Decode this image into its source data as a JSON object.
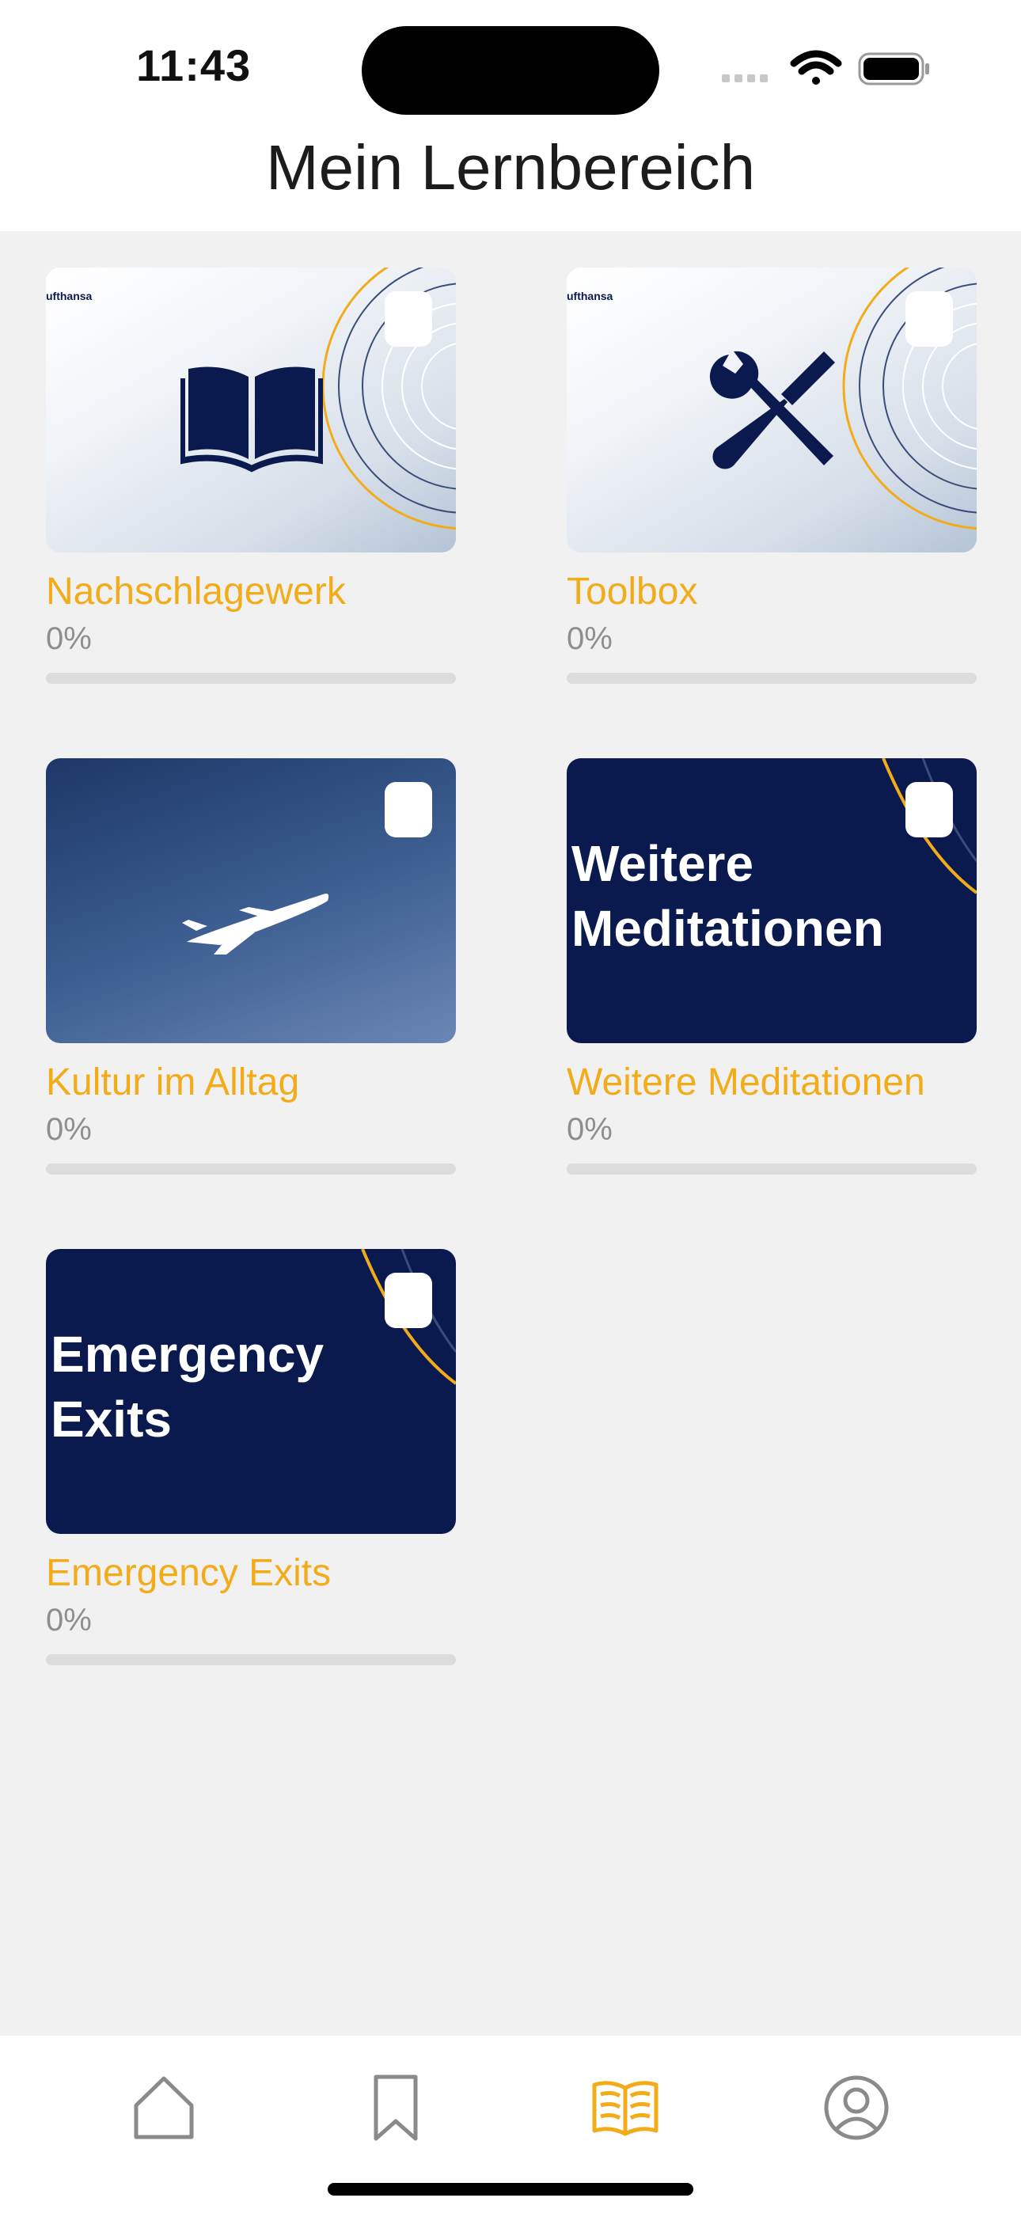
{
  "status_bar": {
    "time": "11:43"
  },
  "header": {
    "title": "Mein Lernbereich"
  },
  "colors": {
    "accent": "#f2ac1a",
    "navy": "#0b1a4e",
    "progress_track": "#dcdcdc"
  },
  "courses": [
    {
      "title": "Nachschlagewerk",
      "progress_label": "0%",
      "progress": 0,
      "brand": "ufthansa",
      "icon": "book-icon"
    },
    {
      "title": "Toolbox",
      "progress_label": "0%",
      "progress": 0,
      "brand": "ufthansa",
      "icon": "tools-icon"
    },
    {
      "title": "Kultur im Alltag",
      "progress_label": "0%",
      "progress": 0,
      "icon": "airplane-icon"
    },
    {
      "title": "Weitere Meditationen",
      "progress_label": "0%",
      "progress": 0,
      "thumb_line1": "Weitere",
      "thumb_line2": "Meditationen"
    },
    {
      "title": "Emergency Exits",
      "progress_label": "0%",
      "progress": 0,
      "thumb_line1": "Emergency",
      "thumb_line2": "Exits"
    }
  ],
  "tabbar": {
    "items": [
      {
        "icon": "home-icon",
        "active": false
      },
      {
        "icon": "bookmark-icon",
        "active": false
      },
      {
        "icon": "open-book-icon",
        "active": true
      },
      {
        "icon": "profile-icon",
        "active": false
      }
    ]
  }
}
